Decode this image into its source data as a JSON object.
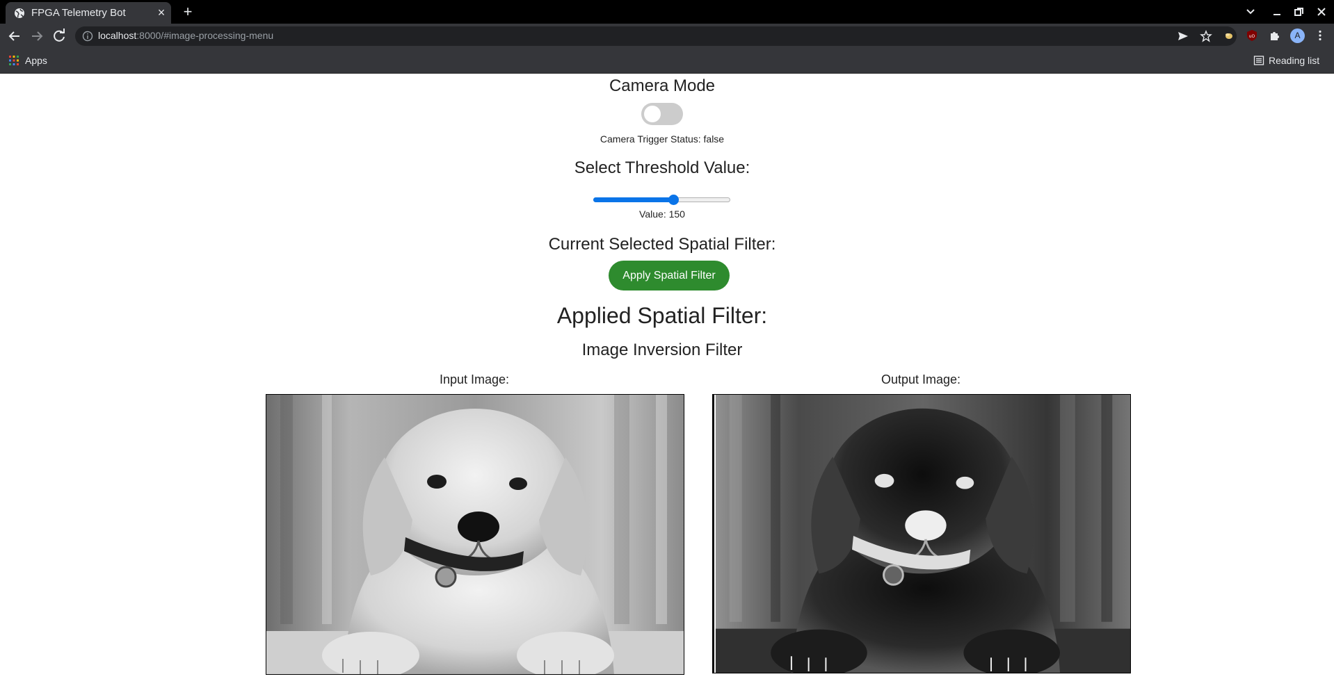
{
  "browser": {
    "tab_title": "FPGA Telemetry Bot",
    "url_host": "localhost",
    "url_rest": ":8000/#image-processing-menu",
    "bookmarks_apps": "Apps",
    "reading_list": "Reading list",
    "profile_initial": "A"
  },
  "page": {
    "camera_heading": "Camera Mode",
    "camera_toggle_on": false,
    "camera_status": "Camera Trigger Status: false",
    "threshold_heading": "Select Threshold Value:",
    "threshold_value": 150,
    "threshold_max": 255,
    "threshold_label": "Value: 150",
    "current_filter_heading": "Current Selected Spatial Filter:",
    "apply_button": "Apply Spatial Filter",
    "applied_heading": "Applied Spatial Filter:",
    "applied_filter_name": "Image Inversion Filter",
    "input_image_label": "Input Image:",
    "output_image_label": "Output Image:"
  },
  "colors": {
    "accent_blue": "#0a74e8",
    "button_green": "#2e8b2e",
    "toggle_off": "#cccccc"
  }
}
